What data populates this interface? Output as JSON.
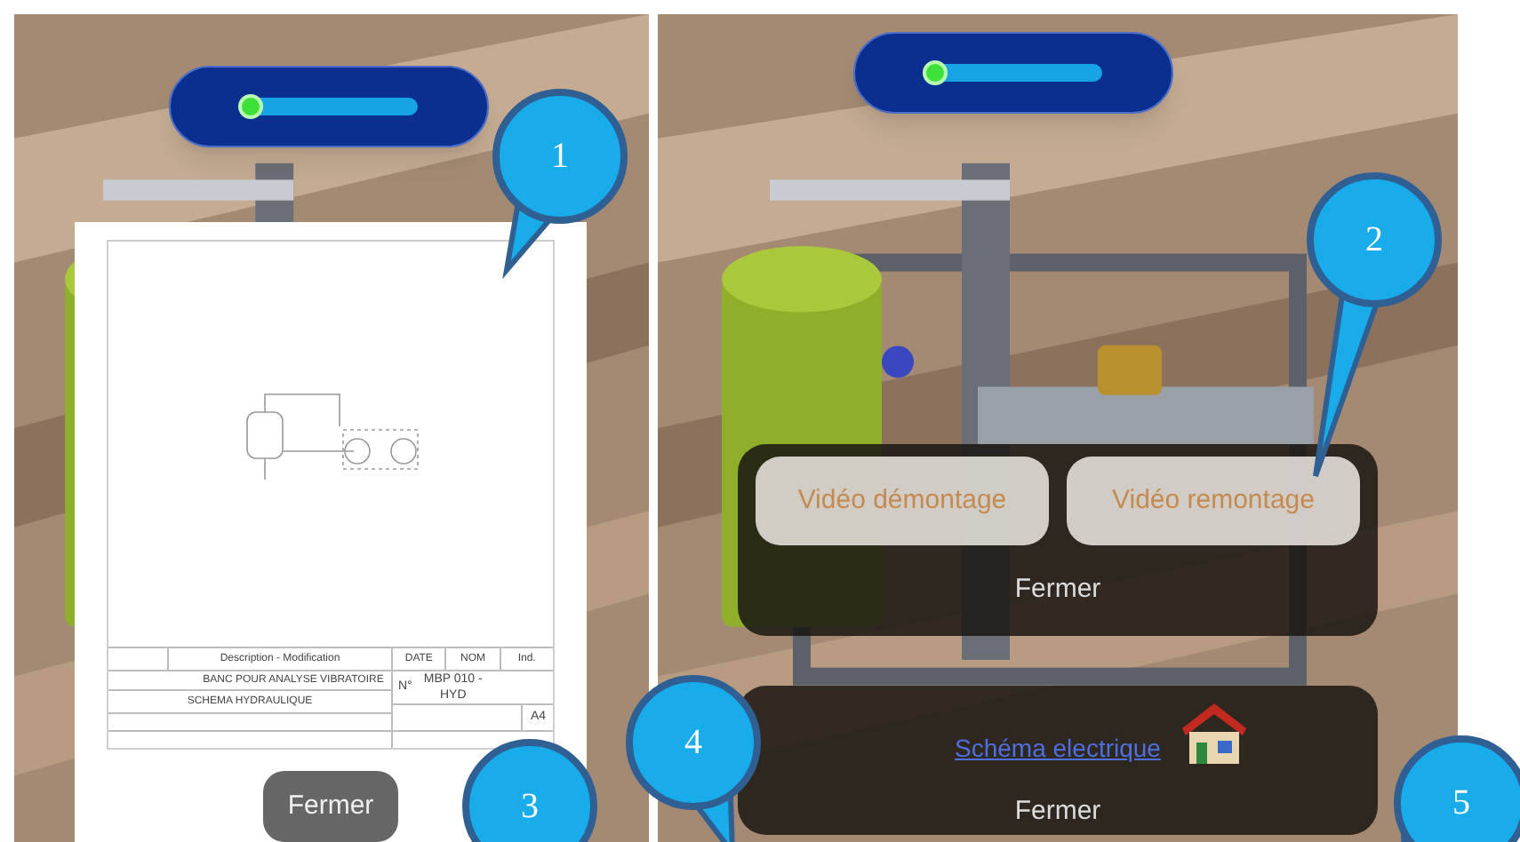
{
  "left_screen": {
    "slider": {
      "level": 0.03
    },
    "document": {
      "header": [
        "Description - Modification",
        "DATE",
        "NOM",
        "Ind."
      ],
      "title": "BANC POUR ANALYSE VIBRATOIRE",
      "number_label": "N°",
      "number": "MBP 010 -HYD",
      "subtitle": "SCHEMA HYDRAULIQUE",
      "format": "A4"
    },
    "close_button": "Fermer"
  },
  "right_screen": {
    "slider": {
      "level": 0.03
    },
    "video_buttons": [
      "Vidéo démontage",
      "Vidéo remontage"
    ],
    "close_button": "Fermer",
    "link": "Schéma electrique",
    "second_close_button": "Fermer"
  },
  "callouts": [
    "1",
    "2",
    "3",
    "4",
    "5"
  ]
}
